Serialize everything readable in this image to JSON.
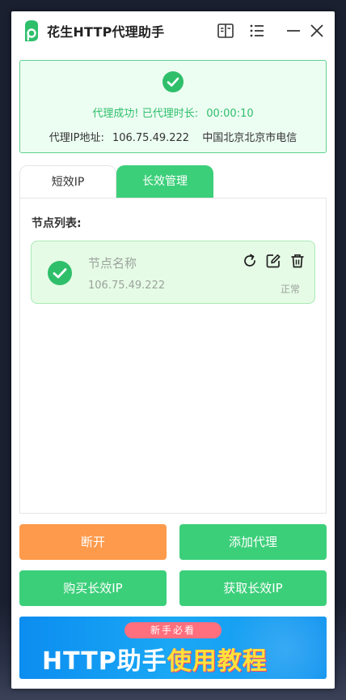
{
  "app": {
    "title": "花生HTTP代理助手"
  },
  "status": {
    "message": "代理成功! 已代理时长:",
    "duration": "00:00:10",
    "ip_label": "代理IP地址:",
    "ip": "106.75.49.222",
    "location": "中国北京北京市电信"
  },
  "tabs": [
    {
      "label": "短效IP",
      "active": false
    },
    {
      "label": "长效管理",
      "active": true
    }
  ],
  "panel": {
    "title": "节点列表:",
    "nodes": [
      {
        "name": "节点名称",
        "ip": "106.75.49.222",
        "status": "正常"
      }
    ]
  },
  "buttons": {
    "disconnect": "断开",
    "add_proxy": "添加代理",
    "buy_long_ip": "购买长效IP",
    "get_long_ip": "获取长效IP"
  },
  "banner": {
    "tag": "新手必看",
    "main": "HTTP助手",
    "highlight": "使用教程"
  },
  "colors": {
    "accent": "#3ccf7a",
    "disconnect": "#fe9a4b",
    "banner_tag": "#ff6f7d",
    "banner_highlight": "#ffe23a"
  },
  "icons": [
    "logo-icon",
    "book-icon",
    "menu-icon",
    "minimize-icon",
    "close-icon",
    "check-circle-icon",
    "refresh-icon",
    "edit-icon",
    "trash-icon"
  ]
}
